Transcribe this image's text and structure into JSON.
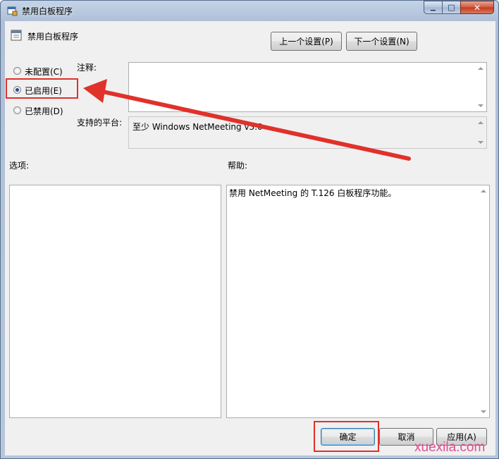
{
  "window": {
    "title": "禁用白板程序",
    "controls": {
      "minimize": "▁",
      "maximize": "□",
      "close": "✕"
    }
  },
  "header": {
    "policy_name": "禁用白板程序",
    "prev_button": "上一个设置(P)",
    "next_button": "下一个设置(N)"
  },
  "state": {
    "options": [
      {
        "label": "未配置(C)",
        "selected": false
      },
      {
        "label": "已启用(E)",
        "selected": true
      },
      {
        "label": "已禁用(D)",
        "selected": false
      }
    ]
  },
  "comment": {
    "label": "注释:",
    "value": ""
  },
  "platform": {
    "label": "支持的平台:",
    "value": "至少 Windows NetMeeting v3.0"
  },
  "options_panel": {
    "label": "选项:"
  },
  "help_panel": {
    "label": "帮助:",
    "text": "禁用 NetMeeting 的 T.126 白板程序功能。"
  },
  "footer": {
    "ok_button": "确定",
    "cancel_button": "取消",
    "apply_button": "应用(A)"
  },
  "watermark": "xuexila.com",
  "colors": {
    "annotation_red": "#e0312a",
    "title_bar": "#b6c7dc"
  }
}
